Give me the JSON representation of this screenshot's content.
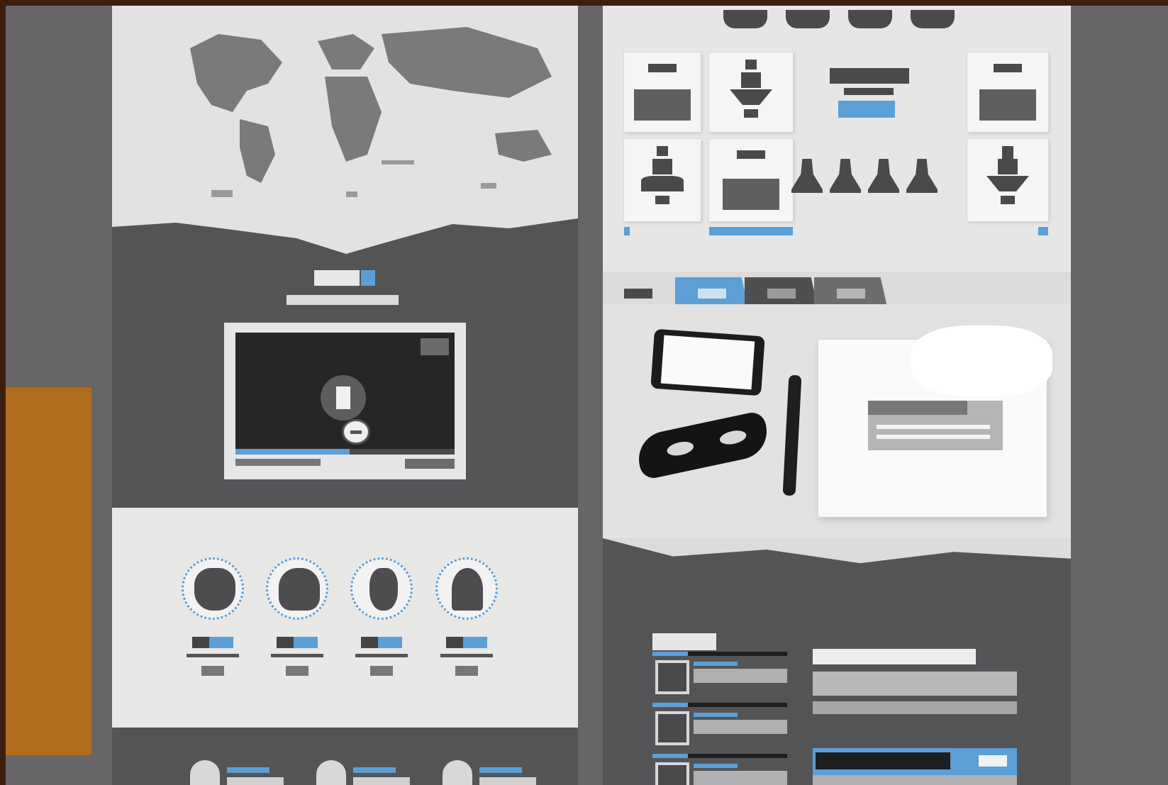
{
  "colors": {
    "frame": "#3b1f0c",
    "backdrop": "#666668",
    "panel_dark": "#545457",
    "panel_light": "#e8e8e7",
    "accent_blue": "#5b9fd6",
    "orange_swatch": "#b06d1e"
  },
  "icons": {
    "play": "play-icon",
    "team_avatars": "avatar-icon",
    "pricing_figures": "person-icon",
    "bells": "bell-icon"
  },
  "video": {
    "progress_fraction": 0.52
  },
  "team": {
    "members": 4
  },
  "gallery": {
    "tabs": 3,
    "active_tab_index": 0
  }
}
